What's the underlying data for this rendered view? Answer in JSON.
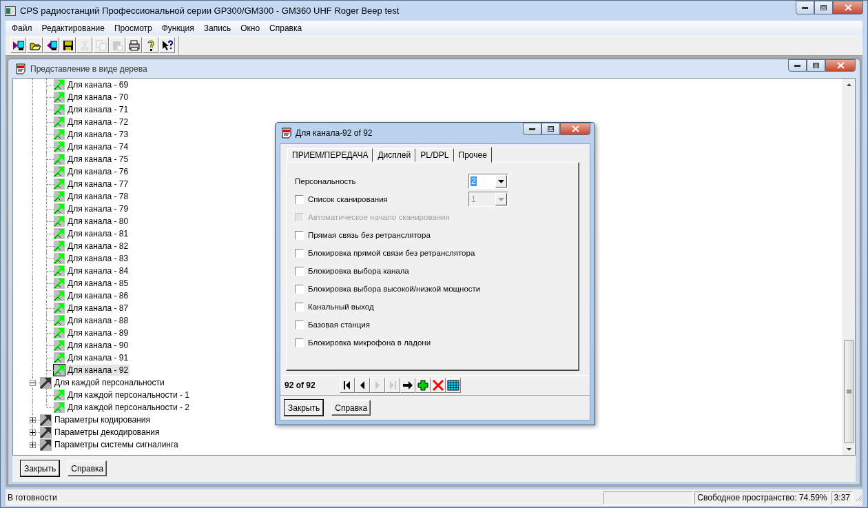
{
  "window": {
    "title": "CPS радиостанций Профессиональной серии GP300/GM300 - GM360 UHF Roger Beep test"
  },
  "menu": [
    "Файл",
    "Редактирование",
    "Просмотр",
    "Функция",
    "Запись",
    "Окно",
    "Справка"
  ],
  "toolbar": [
    {
      "kind": "read",
      "disabled": false
    },
    {
      "kind": "open",
      "disabled": false
    },
    {
      "kind": "write",
      "disabled": false
    },
    {
      "kind": "save",
      "disabled": false
    },
    {
      "kind": "cut",
      "disabled": true
    },
    {
      "kind": "copy",
      "disabled": true
    },
    {
      "kind": "paste",
      "disabled": true
    },
    {
      "kind": "print",
      "disabled": false
    },
    {
      "kind": "help",
      "disabled": false
    },
    {
      "kind": "context_help",
      "disabled": false
    }
  ],
  "tree_window": {
    "title": "Представление в виде дерева",
    "tree": {
      "continued": [
        {
          "label": "Для канала - 69",
          "selected": false
        },
        {
          "label": "Для канала - 70",
          "selected": false
        },
        {
          "label": "Для канала - 71",
          "selected": false
        },
        {
          "label": "Для канала - 72",
          "selected": false
        },
        {
          "label": "Для канала - 73",
          "selected": false
        },
        {
          "label": "Для канала - 74",
          "selected": false
        },
        {
          "label": "Для канала - 75",
          "selected": false
        },
        {
          "label": "Для канала - 76",
          "selected": false
        },
        {
          "label": "Для канала - 77",
          "selected": false
        },
        {
          "label": "Для канала - 78",
          "selected": false
        },
        {
          "label": "Для канала - 79",
          "selected": false
        },
        {
          "label": "Для канала - 80",
          "selected": false
        },
        {
          "label": "Для канала - 81",
          "selected": false
        },
        {
          "label": "Для канала - 82",
          "selected": false
        },
        {
          "label": "Для канала - 83",
          "selected": false
        },
        {
          "label": "Для канала - 84",
          "selected": false
        },
        {
          "label": "Для канала - 85",
          "selected": false
        },
        {
          "label": "Для канала - 86",
          "selected": false
        },
        {
          "label": "Для канала - 87",
          "selected": false
        },
        {
          "label": "Для канала - 88",
          "selected": false
        },
        {
          "label": "Для канала - 89",
          "selected": false
        },
        {
          "label": "Для канала - 90",
          "selected": false
        },
        {
          "label": "Для канала - 91",
          "selected": false
        },
        {
          "label": "Для канала - 92",
          "selected": true
        }
      ],
      "items": [
        {
          "label": "Для каждой персональности",
          "expanded": true,
          "selected": false,
          "children": [
            {
              "label": "Для каждой персональности - 1",
              "selected": false
            },
            {
              "label": "Для каждой персональности - 2",
              "selected": false
            }
          ]
        },
        {
          "label": "Параметры кодирования",
          "expanded": false,
          "selected": false
        },
        {
          "label": "Параметры  декодирования",
          "expanded": false,
          "selected": false
        },
        {
          "label": "Параметры системы сигналинга",
          "expanded": false,
          "selected": false
        }
      ]
    },
    "buttons": [
      "Закрыть",
      "Справка"
    ]
  },
  "dialog": {
    "title": "Для канала-92 of 92",
    "tabs": [
      {
        "label": "ПРИЕМ/ПЕРЕДАЧА",
        "selected": false
      },
      {
        "label": "Дисплей",
        "selected": false
      },
      {
        "label": "PL/DPL",
        "selected": false
      },
      {
        "label": "Прочее",
        "selected": true
      }
    ],
    "personality": {
      "label": "Персональность",
      "value": "2"
    },
    "options": [
      {
        "kind": "with_combo",
        "label": "Список сканирования",
        "checked": false,
        "disabled": false,
        "combo": {
          "value": "1",
          "disabled": true
        }
      },
      {
        "kind": "plain",
        "label": "Автоматическое начало сканирования",
        "checked": false,
        "disabled": true
      },
      {
        "kind": "plain",
        "label": "Прямая связь без ретранслятора",
        "checked": false,
        "disabled": false
      },
      {
        "kind": "plain",
        "label": "Блокировка прямой связи без ретранслятора",
        "checked": false,
        "disabled": false
      },
      {
        "kind": "plain",
        "label": "Блокировка выбора канала",
        "checked": false,
        "disabled": false
      },
      {
        "kind": "plain",
        "label": "Блокировка выбора высокой/низкой мощности",
        "checked": false,
        "disabled": false
      },
      {
        "kind": "plain",
        "label": "Канальный выход",
        "checked": false,
        "disabled": false
      },
      {
        "kind": "plain",
        "label": "Базовая станция",
        "checked": false,
        "disabled": false
      },
      {
        "kind": "plain",
        "label": "Блокировка микрофона в ладони",
        "checked": false,
        "disabled": false
      }
    ],
    "counter": "92 of 92",
    "nav": [
      {
        "kind": "first",
        "disabled": false
      },
      {
        "kind": "prev",
        "disabled": false
      },
      {
        "kind": "next",
        "disabled": true
      },
      {
        "kind": "last",
        "disabled": true
      },
      {
        "kind": "goto",
        "disabled": false
      },
      {
        "kind": "add",
        "disabled": false
      },
      {
        "kind": "delete",
        "disabled": false
      },
      {
        "kind": "table",
        "disabled": false
      }
    ],
    "buttons": [
      "Закрыть",
      "Справка"
    ]
  },
  "status_bar": {
    "message": "В готовности",
    "free_space": "Свободное пространство: 74.59%",
    "time": "3:37"
  }
}
